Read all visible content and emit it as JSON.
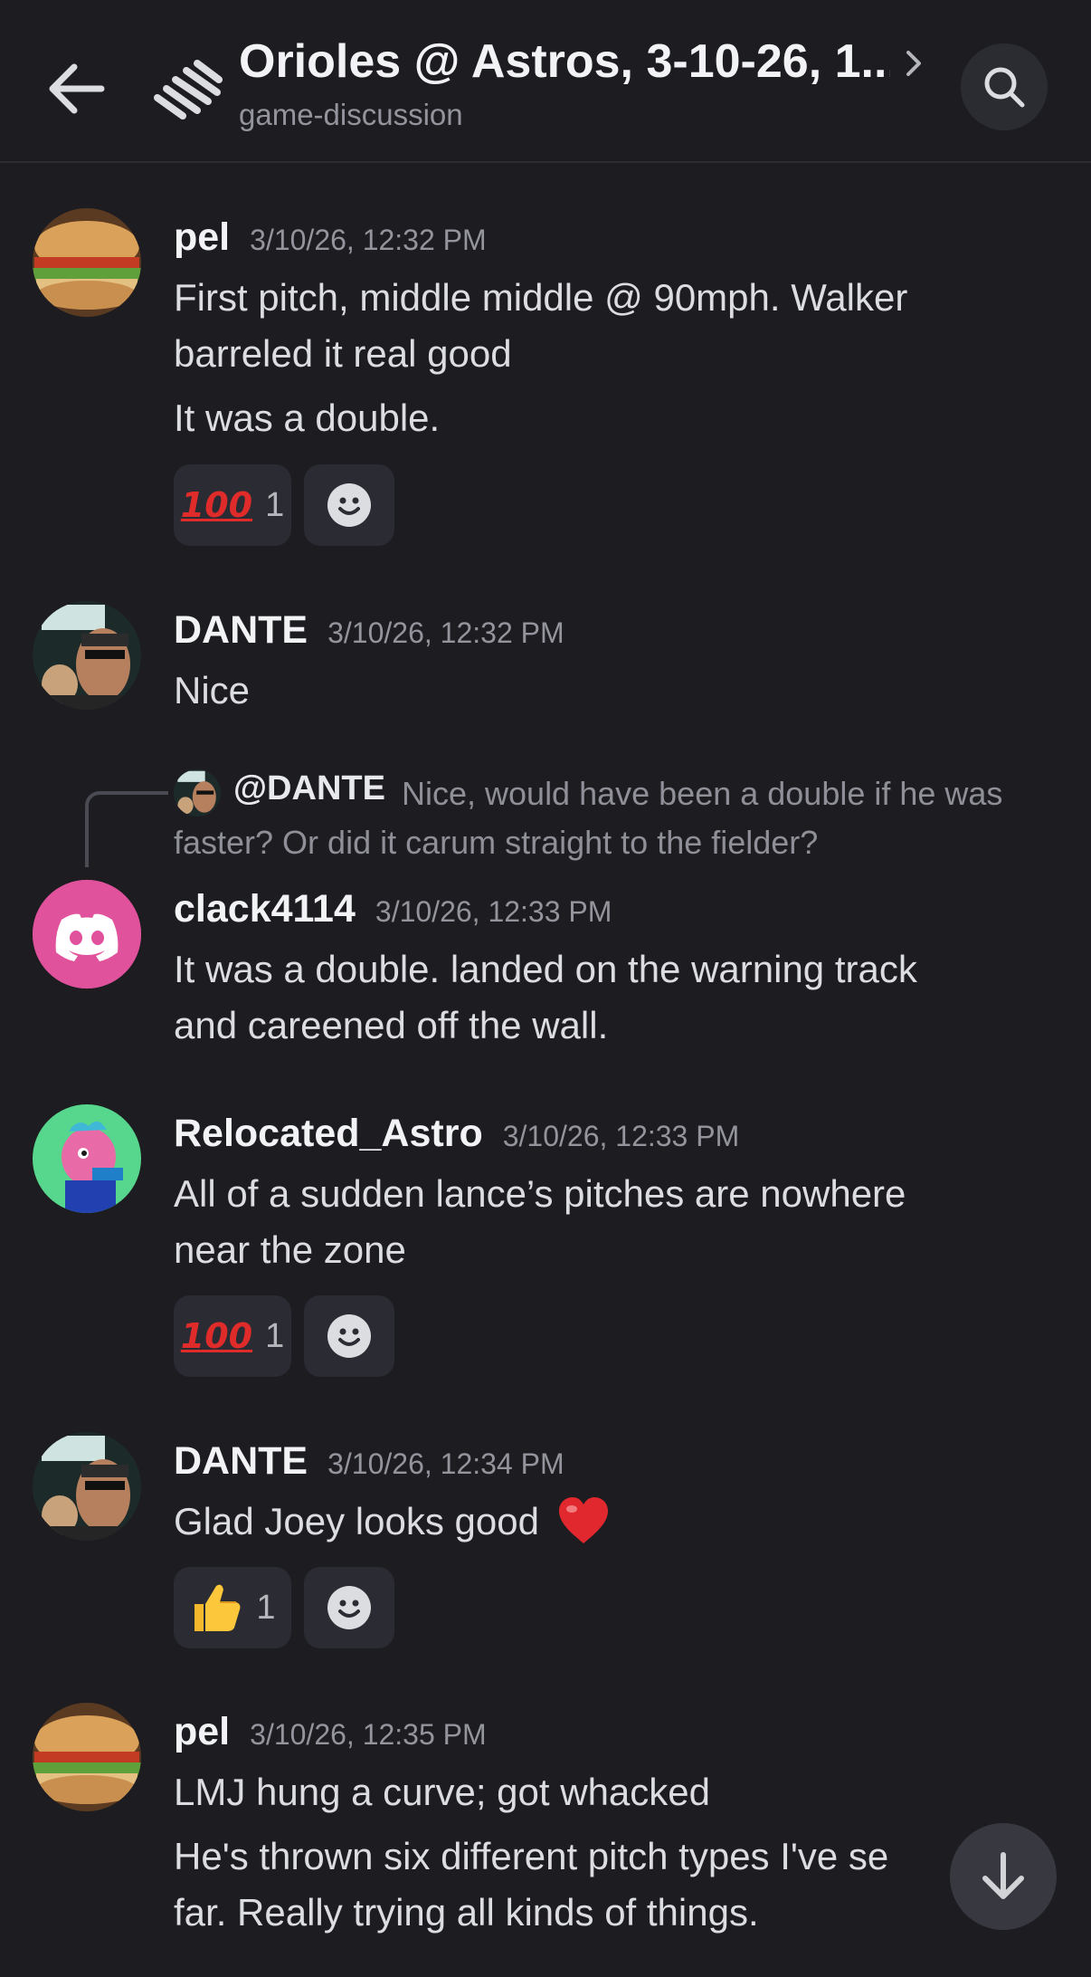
{
  "header": {
    "title": "Orioles @ Astros, 3-10-26, 1...",
    "subtitle": "game-discussion"
  },
  "messages": [
    {
      "username": "pel",
      "timestamp": "3/10/26, 12:32 PM",
      "lines": [
        "First pitch, middle middle @ 90mph.  Walker",
        "barreled it real good",
        "It was a double."
      ],
      "reaction": {
        "emoji": "100",
        "count": "1"
      }
    },
    {
      "username": "DANTE",
      "timestamp": "3/10/26, 12:32 PM",
      "lines": [
        "Nice"
      ]
    },
    {
      "reply": {
        "mention": "@DANTE",
        "text": "Nice, would have been a double if he was faster? Or did it carum straight to the fielder?"
      },
      "username": "clack4114",
      "timestamp": "3/10/26, 12:33 PM",
      "lines": [
        "It was a double.  landed on the warning track",
        "and careened off the wall."
      ]
    },
    {
      "username": "Relocated_Astro",
      "timestamp": "3/10/26, 12:33 PM",
      "lines": [
        "All of a sudden lance’s pitches are nowhere",
        "near the zone"
      ],
      "reaction": {
        "emoji": "100",
        "count": "1"
      }
    },
    {
      "username": "DANTE",
      "timestamp": "3/10/26, 12:34 PM",
      "lines": [
        "Glad Joey looks good"
      ],
      "reaction": {
        "emoji": "thumbs-up",
        "count": "1"
      }
    },
    {
      "username": "pel",
      "timestamp": "3/10/26, 12:35 PM",
      "lines": [
        "LMJ hung a curve;  got whacked",
        "He's thrown six different pitch types I've se",
        "far.  Really trying all kinds of things."
      ]
    }
  ],
  "colors": {
    "background": "#1c1c21",
    "reaction_bg": "#2b2c33",
    "discord_pink": "#e0529c",
    "heart": "#e0282e"
  },
  "icons": {
    "back": "arrow-left-icon",
    "thread": "thread-icon",
    "chevron": "chevron-right-icon",
    "search": "search-icon",
    "add_reaction": "smiley-icon",
    "scroll_down": "arrow-down-icon"
  }
}
